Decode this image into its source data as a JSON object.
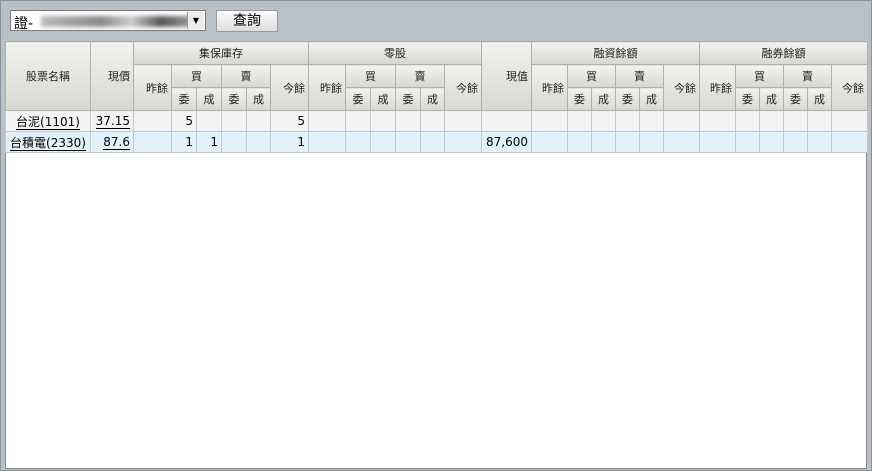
{
  "toolbar": {
    "account_prefix": "證-",
    "query_label": "查詢"
  },
  "headers": {
    "name": "股票名稱",
    "price": "現價",
    "value": "現值",
    "groups": [
      "集保庫存",
      "零股",
      "融資餘額",
      "融券餘額"
    ],
    "prev": "昨餘",
    "buy": "買",
    "sell": "賣",
    "today": "今餘",
    "order": "委",
    "deal": "成"
  },
  "rows": [
    {
      "name": "台泥(1101)",
      "price": "37.15",
      "cells": [
        "",
        "5",
        "",
        "",
        "",
        "5",
        "",
        "",
        "",
        "",
        "",
        "",
        "",
        "",
        "",
        "",
        "",
        "",
        "",
        "",
        "",
        "",
        "",
        "",
        "",
        ""
      ]
    },
    {
      "name": "台積電(2330)",
      "price": "87.6",
      "cells": [
        "",
        "1",
        "1",
        "",
        "",
        "1",
        "",
        "",
        "",
        "",
        "",
        "",
        "87,600",
        "",
        "",
        "",
        "",
        "",
        "",
        "",
        "",
        "",
        "",
        "",
        "",
        ""
      ]
    }
  ]
}
